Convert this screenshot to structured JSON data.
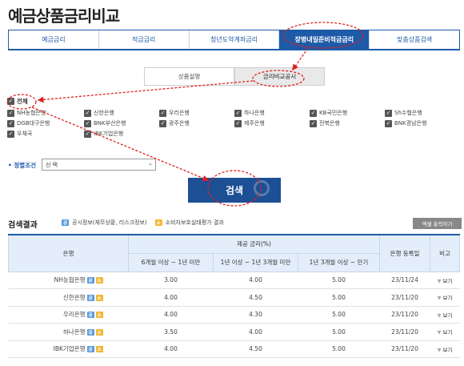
{
  "page_title": "예금상품금리비교",
  "tabs": [
    "예금금리",
    "적금금리",
    "청년도약계좌금리",
    "장병내일준비적금금리",
    "맞춤상품검색"
  ],
  "active_tab_index": 3,
  "subtabs": [
    "상품설명",
    "금리비교공시"
  ],
  "active_subtab_index": 1,
  "check_all_label": "전체",
  "banks": [
    "NH농협은행",
    "신한은행",
    "우리은행",
    "하나은행",
    "KB국민은행",
    "Sh수협은행",
    "DGB대구은행",
    "BNK부산은행",
    "광주은행",
    "제주은행",
    "전북은행",
    "BNK경남은행",
    "우체국",
    "IBK기업은행"
  ],
  "sort": {
    "label": "정렬조건",
    "value": "선 택"
  },
  "search_button": "검색",
  "results": {
    "title": "검색결과",
    "legend_public": "공시정보(재무상황, 리스크정보)",
    "legend_consumer": "소비자보호실태평가 결과",
    "legend_icon_a": "공",
    "legend_icon_b": "소",
    "excel_button": "엑셀 출력하기",
    "headers": {
      "bank": "은행",
      "rate_group": "제공 금리(%)",
      "rate_cols": [
        "6개월 이상 ~ 1년 미만",
        "1년 이상 ~ 1년 3개월 미만",
        "1년 3개월 이상 ~ 만기"
      ],
      "date": "은행 등록일",
      "note": "비고"
    },
    "more_label": "보기",
    "rows": [
      {
        "bank": "NH농협은행",
        "r1": "3.00",
        "r2": "4.00",
        "r3": "5.00",
        "date": "23/11/24"
      },
      {
        "bank": "신한은행",
        "r1": "4.00",
        "r2": "4.50",
        "r3": "5.00",
        "date": "23/11/20"
      },
      {
        "bank": "우리은행",
        "r1": "4.00",
        "r2": "4.30",
        "r3": "5.00",
        "date": "23/11/20"
      },
      {
        "bank": "하나은행",
        "r1": "3.50",
        "r2": "4.00",
        "r3": "5.00",
        "date": "23/11/20"
      },
      {
        "bank": "IBK기업은행",
        "r1": "4.00",
        "r2": "4.50",
        "r3": "5.00",
        "date": "23/11/20"
      }
    ]
  },
  "colors": {
    "primary": "#1d5aa8",
    "search_bg": "#1d4f94",
    "annotation": "#e02020"
  }
}
